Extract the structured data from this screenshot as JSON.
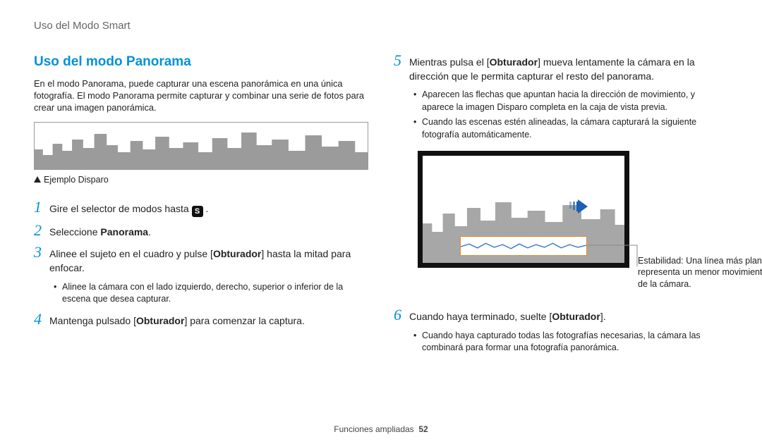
{
  "breadcrumb": "Uso del Modo Smart",
  "section_title": "Uso del modo Panorama",
  "intro": "En el modo Panorama, puede capturar una escena panorámica en una única fotografía. El modo Panorama permite capturar y combinar una serie de fotos para crear una imagen panorámica.",
  "example_caption": "Ejemplo Disparo",
  "mode_icon_label": "S",
  "steps": {
    "s1_pre": "Gire el selector de modos hasta ",
    "s1_post": " .",
    "s2_pre": "Seleccione ",
    "s2_bold": "Panorama",
    "s2_post": ".",
    "s3_a": "Alinee el sujeto en el cuadro y pulse [",
    "s3_bold": "Obturador",
    "s3_b": "] hasta la mitad para enfocar.",
    "s3_bullet": "Alinee la cámara con el lado izquierdo, derecho, superior o inferior de la escena que desea capturar.",
    "s4_a": "Mantenga pulsado [",
    "s4_bold": "Obturador",
    "s4_b": "] para comenzar la captura.",
    "s5_a": "Mientras pulsa el [",
    "s5_bold": "Obturador",
    "s5_b": "] mueva lentamente la cámara en la dirección que le permita capturar el resto del panorama.",
    "s5_bullet1": "Aparecen las flechas que apuntan hacia la dirección de movimiento, y aparece la imagen Disparo completa en la caja de vista previa.",
    "s5_bullet2": "Cuando las escenas estén alineadas, la cámara capturará la siguiente fotografía automáticamente.",
    "s6_a": "Cuando haya terminado, suelte [",
    "s6_bold": "Obturador",
    "s6_b": "].",
    "s6_bullet": "Cuando haya capturado todas las fotografías necesarias, la cámara las combinará para formar una fotografía panorámica."
  },
  "callout": "Estabilidad: Una línea más plana representa un menor movimiento de la cámara.",
  "footer_label": "Funciones ampliadas",
  "page_number": "52"
}
